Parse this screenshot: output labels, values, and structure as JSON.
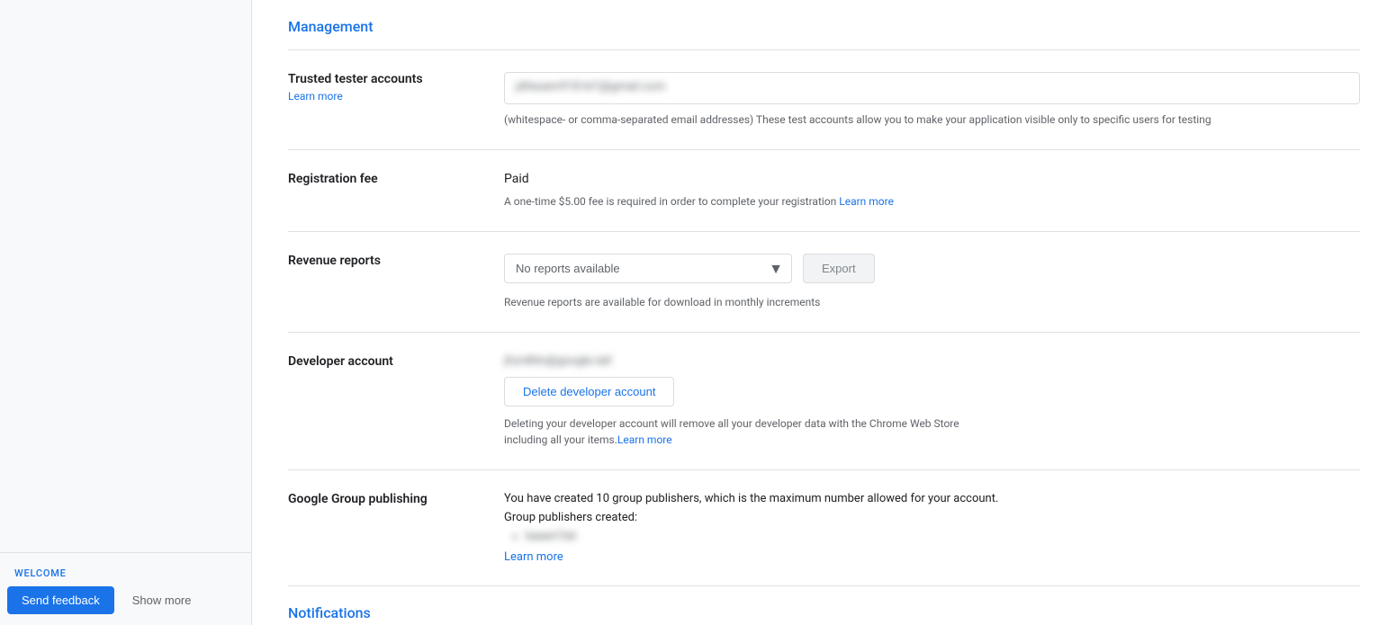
{
  "sidebar": {
    "welcome_label": "WELCOME",
    "send_feedback_label": "Send feedback",
    "show_more_label": "Show more"
  },
  "main": {
    "management_link": "Management",
    "notifications_link": "Notifications",
    "sections": {
      "trusted_tester": {
        "label": "Trusted tester accounts",
        "learn_more": "Learn more",
        "input_placeholder": "jdheuenr918 kt1@gmail.com",
        "helper_text": "(whitespace- or comma-separated email addresses) These test accounts allow you to make your application visible only to specific users for testing"
      },
      "registration_fee": {
        "label": "Registration fee",
        "status": "Paid",
        "description": "A one-time $5.00 fee is required in order to complete your registration",
        "learn_more": "Learn more"
      },
      "revenue_reports": {
        "label": "Revenue reports",
        "select_option": "No reports available",
        "export_button": "Export",
        "helper_text": "Revenue reports are available for download in monthly increments"
      },
      "developer_account": {
        "label": "Developer account",
        "email_blurred": "jfun4litn@google.tall",
        "delete_button": "Delete developer account",
        "delete_note": "Deleting your developer account will remove all your developer data with the Chrome Web Store including all your items.",
        "learn_more": "Learn more"
      },
      "google_group_publishing": {
        "label": "Google Group publishing",
        "description": "You have created 10 group publishers, which is the maximum number allowed for your account.",
        "publishers_created": "Group publishers created:",
        "publisher_entry": "baeeri7eli",
        "learn_more": "Learn more"
      }
    }
  }
}
